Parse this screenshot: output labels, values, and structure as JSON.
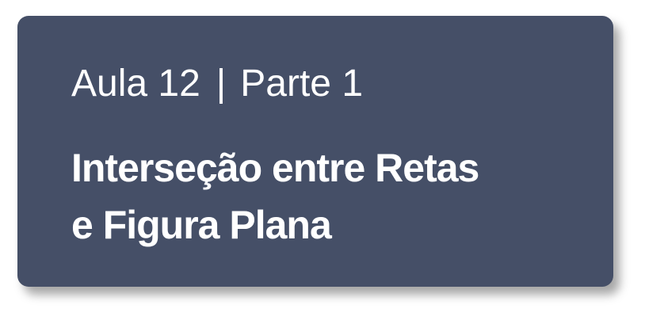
{
  "header": {
    "lesson_label": "Aula 12",
    "separator": "|",
    "part_label": "Parte 1"
  },
  "title": {
    "line1": "Interseção entre Retas",
    "line2": "e Figura Plana"
  },
  "colors": {
    "card_background": "#454f67",
    "text": "#ffffff",
    "page_background": "#ffffff"
  }
}
